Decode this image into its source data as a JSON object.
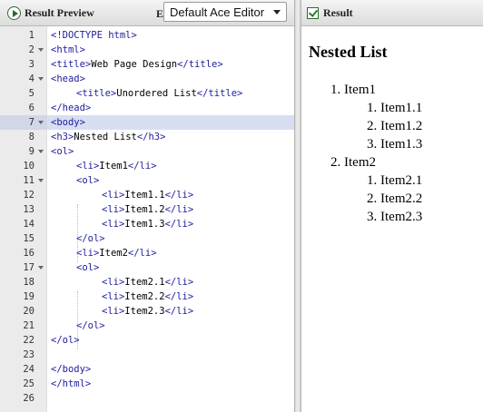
{
  "toolbar": {
    "preview_label": "Result Preview",
    "tab_stub": "E",
    "theme_select": "Default Ace Editor"
  },
  "result_toolbar": {
    "label": "Result"
  },
  "editor": {
    "active_line": 7,
    "lines": [
      {
        "n": "1",
        "fold": false,
        "parts": [
          {
            "t": "tag",
            "v": "<!DOCTYPE html>"
          }
        ]
      },
      {
        "n": "2",
        "fold": true,
        "parts": [
          {
            "t": "tag",
            "v": "<html>"
          }
        ]
      },
      {
        "n": "3",
        "fold": false,
        "parts": [
          {
            "t": "tag",
            "v": "<title>"
          },
          {
            "t": "txt",
            "v": "Web Page Design"
          },
          {
            "t": "tag",
            "v": "</title>"
          }
        ]
      },
      {
        "n": "4",
        "fold": true,
        "parts": [
          {
            "t": "tag",
            "v": "<head>"
          }
        ]
      },
      {
        "n": "5",
        "fold": false,
        "indent": 1,
        "parts": [
          {
            "t": "tag",
            "v": "<title>"
          },
          {
            "t": "txt",
            "v": "Unordered List"
          },
          {
            "t": "tag",
            "v": "</title>"
          }
        ]
      },
      {
        "n": "6",
        "fold": false,
        "parts": [
          {
            "t": "tag",
            "v": "</head>"
          }
        ]
      },
      {
        "n": "7",
        "fold": true,
        "parts": [
          {
            "t": "tag",
            "v": "<body>"
          }
        ]
      },
      {
        "n": "8",
        "fold": false,
        "parts": [
          {
            "t": "tag",
            "v": "<h3>"
          },
          {
            "t": "txt",
            "v": "Nested List"
          },
          {
            "t": "tag",
            "v": "</h3>"
          }
        ]
      },
      {
        "n": "9",
        "fold": true,
        "parts": [
          {
            "t": "tag",
            "v": "<ol>"
          }
        ]
      },
      {
        "n": "10",
        "fold": false,
        "indent": 1,
        "parts": [
          {
            "t": "tag",
            "v": "<li>"
          },
          {
            "t": "txt",
            "v": "Item1"
          },
          {
            "t": "tag",
            "v": "</li>"
          }
        ]
      },
      {
        "n": "11",
        "fold": true,
        "indent": 1,
        "parts": [
          {
            "t": "tag",
            "v": "<ol>"
          }
        ]
      },
      {
        "n": "12",
        "fold": false,
        "indent": 2,
        "parts": [
          {
            "t": "tag",
            "v": "<li>"
          },
          {
            "t": "txt",
            "v": "Item1.1"
          },
          {
            "t": "tag",
            "v": "</li>"
          }
        ]
      },
      {
        "n": "13",
        "fold": false,
        "indent": 2,
        "parts": [
          {
            "t": "tag",
            "v": "<li>"
          },
          {
            "t": "txt",
            "v": "Item1.2"
          },
          {
            "t": "tag",
            "v": "</li>"
          }
        ]
      },
      {
        "n": "14",
        "fold": false,
        "indent": 2,
        "parts": [
          {
            "t": "tag",
            "v": "<li>"
          },
          {
            "t": "txt",
            "v": "Item1.3"
          },
          {
            "t": "tag",
            "v": "</li>"
          }
        ]
      },
      {
        "n": "15",
        "fold": false,
        "indent": 1,
        "parts": [
          {
            "t": "tag",
            "v": "</ol>"
          }
        ]
      },
      {
        "n": "16",
        "fold": false,
        "indent": 1,
        "parts": [
          {
            "t": "tag",
            "v": "<li>"
          },
          {
            "t": "txt",
            "v": "Item2"
          },
          {
            "t": "tag",
            "v": "</li>"
          }
        ]
      },
      {
        "n": "17",
        "fold": true,
        "indent": 1,
        "parts": [
          {
            "t": "tag",
            "v": "<ol>"
          }
        ]
      },
      {
        "n": "18",
        "fold": false,
        "indent": 2,
        "parts": [
          {
            "t": "tag",
            "v": "<li>"
          },
          {
            "t": "txt",
            "v": "Item2.1"
          },
          {
            "t": "tag",
            "v": "</li>"
          }
        ]
      },
      {
        "n": "19",
        "fold": false,
        "indent": 2,
        "parts": [
          {
            "t": "tag",
            "v": "<li>"
          },
          {
            "t": "txt",
            "v": "Item2.2"
          },
          {
            "t": "tag",
            "v": "</li>"
          }
        ]
      },
      {
        "n": "20",
        "fold": false,
        "indent": 2,
        "parts": [
          {
            "t": "tag",
            "v": "<li>"
          },
          {
            "t": "txt",
            "v": "Item2.3"
          },
          {
            "t": "tag",
            "v": "</li>"
          }
        ]
      },
      {
        "n": "21",
        "fold": false,
        "indent": 1,
        "parts": [
          {
            "t": "tag",
            "v": "</ol>"
          }
        ]
      },
      {
        "n": "22",
        "fold": false,
        "parts": [
          {
            "t": "tag",
            "v": "</ol>"
          }
        ]
      },
      {
        "n": "23",
        "fold": false,
        "parts": []
      },
      {
        "n": "24",
        "fold": false,
        "parts": [
          {
            "t": "tag",
            "v": "</body>"
          }
        ]
      },
      {
        "n": "25",
        "fold": false,
        "parts": [
          {
            "t": "tag",
            "v": "</html>"
          }
        ]
      },
      {
        "n": "26",
        "fold": false,
        "parts": []
      }
    ]
  },
  "result": {
    "title": "Nested List",
    "items": [
      {
        "marker": "1.",
        "label": "Item1",
        "children": [
          {
            "marker": "1.",
            "label": "Item1.1"
          },
          {
            "marker": "2.",
            "label": "Item1.2"
          },
          {
            "marker": "3.",
            "label": "Item1.3"
          }
        ]
      },
      {
        "marker": "2.",
        "label": "Item2",
        "children": [
          {
            "marker": "1.",
            "label": "Item2.1"
          },
          {
            "marker": "2.",
            "label": "Item2.2"
          },
          {
            "marker": "3.",
            "label": "Item2.3"
          }
        ]
      }
    ]
  },
  "colors": {
    "tag": "#1c1c9c",
    "active_line": "#d8def2",
    "gutter": "#ebebeb"
  }
}
